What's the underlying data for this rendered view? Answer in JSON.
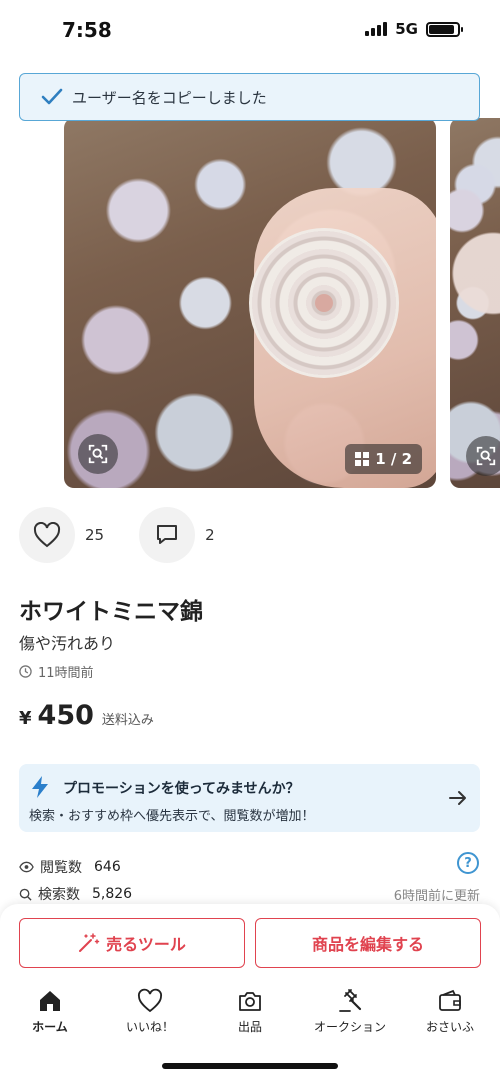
{
  "status": {
    "time": "7:58",
    "network": "5G",
    "battery_level": 0.9
  },
  "toast": {
    "message": "ユーザー名をコピーしました",
    "icon": "check-icon"
  },
  "gallery": {
    "counter": "1 / 2",
    "lens_icon": "lens-search-icon"
  },
  "reactions": {
    "likes": "25",
    "comments": "2"
  },
  "item": {
    "title": "ホワイトミニマ錦",
    "condition": "傷や汚れあり",
    "posted": "11時間前",
    "price_symbol": "¥",
    "price": "450",
    "shipping": "送料込み"
  },
  "promo": {
    "title": "プロモーションを使ってみませんか？",
    "description": "検索・おすすめ枠へ優先表示で、閲覧数が増加！"
  },
  "stats": {
    "views_label": "閲覧数",
    "views": "646",
    "searches_label": "検索数",
    "searches": "5,826",
    "updated": "6時間前に更新"
  },
  "actions": {
    "tools": "売るツール",
    "edit": "商品を編集する"
  },
  "tabs": [
    {
      "label": "ホーム",
      "icon": "home-icon",
      "active": true
    },
    {
      "label": "いいね！",
      "icon": "heart-icon",
      "active": false
    },
    {
      "label": "出品",
      "icon": "camera-icon",
      "active": false
    },
    {
      "label": "オークション",
      "icon": "gavel-icon",
      "active": false
    },
    {
      "label": "おさいふ",
      "icon": "wallet-icon",
      "active": false
    }
  ],
  "colors": {
    "accent": "#e0434f",
    "info": "#3f95d1",
    "toast_bg": "#eaf4fb",
    "promo_bg": "#e8f3fb"
  }
}
